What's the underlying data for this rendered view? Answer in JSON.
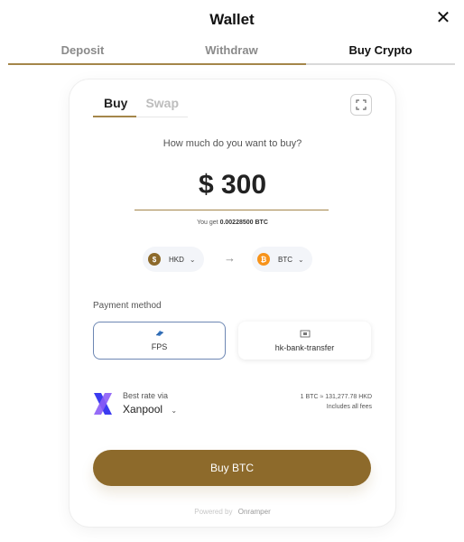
{
  "header": {
    "title": "Wallet",
    "close_glyph": "✕"
  },
  "tabs": [
    {
      "label": "Deposit",
      "active": false
    },
    {
      "label": "Withdraw",
      "active": false
    },
    {
      "label": "Buy Crypto",
      "active": true
    }
  ],
  "widget": {
    "subtabs": [
      {
        "label": "Buy",
        "active": true
      },
      {
        "label": "Swap",
        "active": false
      }
    ],
    "expand_icon": "expand-icon",
    "question": "How much do you want to buy?",
    "amount": "$ 300",
    "you_get_prefix": "You get",
    "you_get_value": "0.00228500 BTC",
    "from_currency": {
      "code": "HKD",
      "symbol": "$",
      "color": "#8d6a2b"
    },
    "to_currency": {
      "code": "BTC",
      "symbol": "₿",
      "color": "#f7931a"
    },
    "arrow_glyph": "→",
    "payment_method_label": "Payment method",
    "payment_methods": [
      {
        "label": "FPS",
        "selected": true,
        "icon": "fps-icon"
      },
      {
        "label": "hk-bank-transfer",
        "selected": false,
        "icon": "bank-icon"
      }
    ],
    "provider": {
      "best_rate_label": "Best rate via",
      "name": "Xanpool",
      "rate_line": "1 BTC ≈ 131,277.78 HKD",
      "fees_line": "Includes all fees",
      "logo_colors": [
        "#3b3bf0",
        "#8b5cf6"
      ]
    },
    "buy_button": "Buy BTC",
    "powered_by": "Powered by",
    "powered_brand": "Onramper",
    "accent_color": "#8d6a2b"
  }
}
